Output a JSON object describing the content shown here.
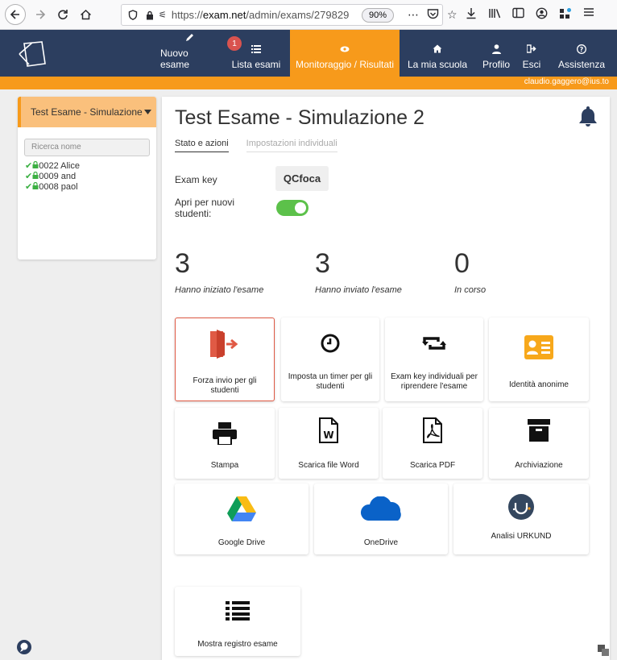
{
  "browser": {
    "url_prefix": "https://",
    "url_host": "exam.net",
    "url_path": "/admin/exams/279829",
    "zoom": "90%"
  },
  "header": {
    "nav": [
      {
        "label": "Nuovo esame",
        "icon": "pencil-icon"
      },
      {
        "label": "Lista esami",
        "icon": "list-icon",
        "badge": "1"
      },
      {
        "label": "Monitoraggio / Risultati",
        "icon": "eye-icon",
        "active": true
      },
      {
        "label": "La mia scuola",
        "icon": "home-icon"
      },
      {
        "label": "Profilo",
        "icon": "user-icon"
      },
      {
        "label": "Esci",
        "icon": "sign-out-icon"
      },
      {
        "label": "Assistenza",
        "icon": "help-icon"
      }
    ],
    "user_email": "claudio.gaggero@ius.to"
  },
  "sidebar": {
    "exam_name": "Test Esame - Simulazione",
    "search_placeholder": "Ricerca nome",
    "students": [
      {
        "label": "0022 Alice"
      },
      {
        "label": "0009 and"
      },
      {
        "label": "0008 paol"
      }
    ]
  },
  "main": {
    "title": "Test Esame - Simulazione 2",
    "tabs": [
      "Stato e azioni",
      "Impostazioni individuali"
    ],
    "exam_key_label": "Exam key",
    "exam_key_value": "QCfoca",
    "open_label": "Apri per nuovi studenti:",
    "open_enabled": true,
    "stats": [
      {
        "value": "3",
        "label": "Hanno iniziato l'esame"
      },
      {
        "value": "3",
        "label": "Hanno inviato l'esame"
      },
      {
        "value": "0",
        "label": "In corso"
      }
    ],
    "actions": [
      {
        "label": "Forza invio per gli studenti",
        "icon": "force-submit-icon"
      },
      {
        "label": "Imposta un timer per gli studenti",
        "icon": "clock-icon"
      },
      {
        "label": "Exam key individuali per riprendere l'esame",
        "icon": "retweet-icon"
      },
      {
        "label": "Identità anonime",
        "icon": "id-card-icon"
      },
      {
        "label": "Stampa",
        "icon": "print-icon"
      },
      {
        "label": "Scarica file Word",
        "icon": "word-file-icon"
      },
      {
        "label": "Scarica PDF",
        "icon": "pdf-file-icon"
      },
      {
        "label": "Archiviazione",
        "icon": "archive-icon"
      },
      {
        "label": "Google Drive",
        "icon": "google-drive-icon"
      },
      {
        "label": "OneDrive",
        "icon": "onedrive-icon"
      },
      {
        "label": "Analisi URKUND",
        "icon": "urkund-icon"
      },
      {
        "label": "Mostra registro esame",
        "icon": "list-log-icon"
      }
    ]
  },
  "colors": {
    "header_bg": "#2c3e5f",
    "accent": "#f79a1b",
    "toggle_on": "#5cc14a",
    "danger": "#e05a45"
  }
}
